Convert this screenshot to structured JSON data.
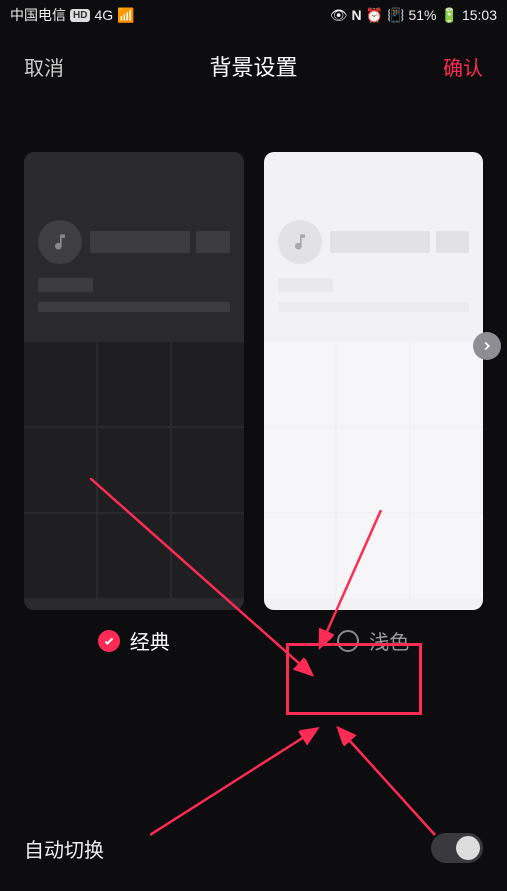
{
  "status": {
    "carrier": "中国电信",
    "hd": "HD",
    "network": "4G",
    "battery": "51%",
    "time": "15:03"
  },
  "header": {
    "cancel": "取消",
    "title": "背景设置",
    "confirm": "确认"
  },
  "themes": {
    "classic": {
      "label": "经典",
      "selected": true
    },
    "light": {
      "label": "浅色",
      "selected": false
    }
  },
  "auto_switch": {
    "label": "自动切换",
    "on": false
  },
  "colors": {
    "accent": "#fe2c55"
  }
}
